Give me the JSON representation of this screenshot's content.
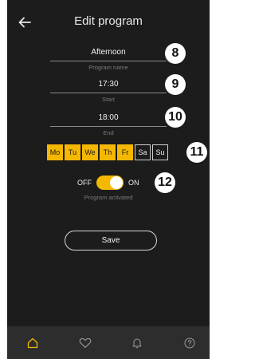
{
  "header": {
    "title": "Edit program",
    "back_icon": "arrow-left-icon"
  },
  "fields": {
    "name": {
      "value": "Afternoon",
      "label": "Program name",
      "badge": "8"
    },
    "start": {
      "value": "17:30",
      "label": "Start",
      "badge": "9"
    },
    "end": {
      "value": "18:00",
      "label": "End",
      "badge": "10"
    }
  },
  "days": {
    "badge": "11",
    "items": [
      {
        "label": "Mo",
        "active": true
      },
      {
        "label": "Tu",
        "active": true
      },
      {
        "label": "We",
        "active": true
      },
      {
        "label": "Th",
        "active": true
      },
      {
        "label": "Fr",
        "active": true
      },
      {
        "label": "Sa",
        "active": false
      },
      {
        "label": "Su",
        "active": false
      }
    ]
  },
  "toggle": {
    "off_label": "OFF",
    "on_label": "ON",
    "state": "on",
    "caption": "Program activated",
    "badge": "12"
  },
  "save_label": "Save",
  "nav": {
    "items": [
      "home-icon",
      "heart-icon",
      "bell-icon",
      "help-icon"
    ],
    "active": "home-icon"
  },
  "colors": {
    "accent": "#f5b800",
    "background": "#1c1c1c",
    "navbar": "#2d2d2d",
    "badge": "#ffffff"
  }
}
